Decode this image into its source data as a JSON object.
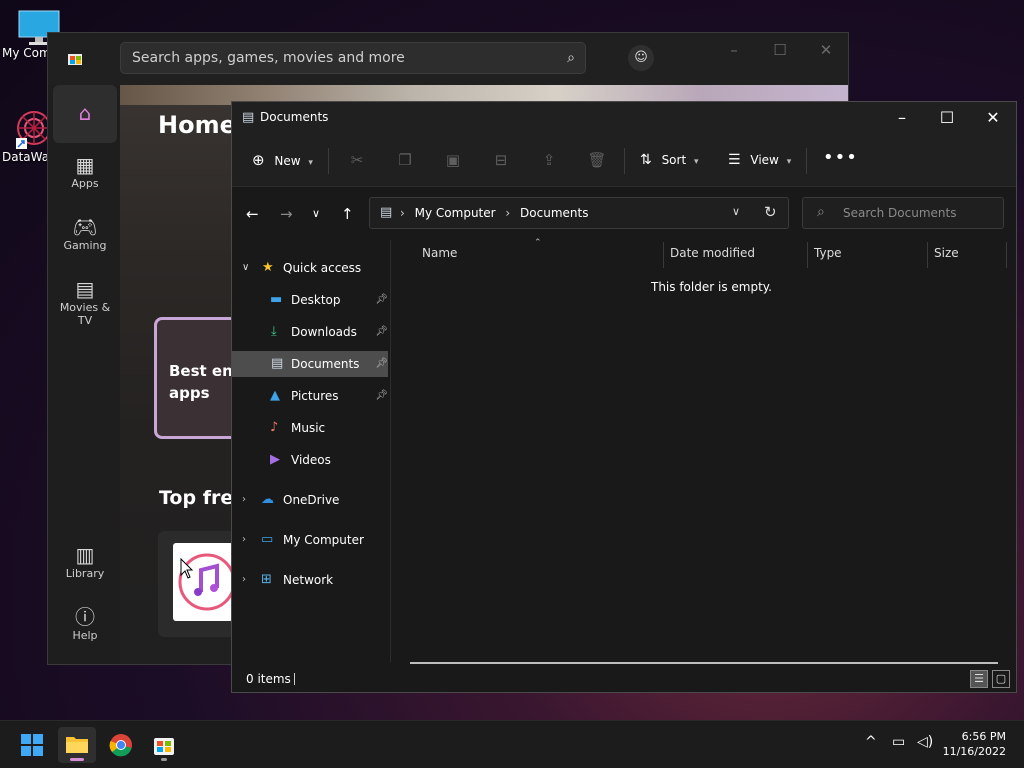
{
  "desktop": {
    "icons": [
      {
        "label": "My Computer",
        "icon": "monitor-icon"
      },
      {
        "label": "DataWagon",
        "icon": "shortcut-icon"
      }
    ]
  },
  "store": {
    "search_placeholder": "Search apps, games, movies and more",
    "nav": [
      {
        "label": "",
        "icon": "home-icon",
        "active": true
      },
      {
        "label": "Apps",
        "icon": "apps-icon"
      },
      {
        "label": "Gaming",
        "icon": "gamepad-icon"
      },
      {
        "label": "Movies & TV",
        "icon": "clapper-icon"
      },
      {
        "label": "Library",
        "icon": "library-icon"
      },
      {
        "label": "Help",
        "icon": "help-icon"
      }
    ],
    "page_title": "Home",
    "promo_text": "Best ente apps",
    "section_title": "Top free"
  },
  "explorer": {
    "title": "Documents",
    "toolbar": {
      "new_label": "New",
      "sort_label": "Sort",
      "view_label": "View"
    },
    "breadcrumbs": [
      "My Computer",
      "Documents"
    ],
    "search_placeholder": "Search Documents",
    "tree": {
      "quick_access": "Quick access",
      "items": [
        {
          "label": "Desktop",
          "pinned": true
        },
        {
          "label": "Downloads",
          "pinned": true
        },
        {
          "label": "Documents",
          "pinned": true,
          "selected": true
        },
        {
          "label": "Pictures",
          "pinned": true
        },
        {
          "label": "Music",
          "pinned": false
        },
        {
          "label": "Videos",
          "pinned": false
        }
      ],
      "onedrive": "OneDrive",
      "my_computer": "My Computer",
      "network": "Network"
    },
    "columns": [
      "Name",
      "Date modified",
      "Type",
      "Size"
    ],
    "empty_message": "This folder is empty.",
    "status": "0 items"
  },
  "taskbar": {
    "time": "6:56 PM",
    "date": "11/16/2022"
  }
}
